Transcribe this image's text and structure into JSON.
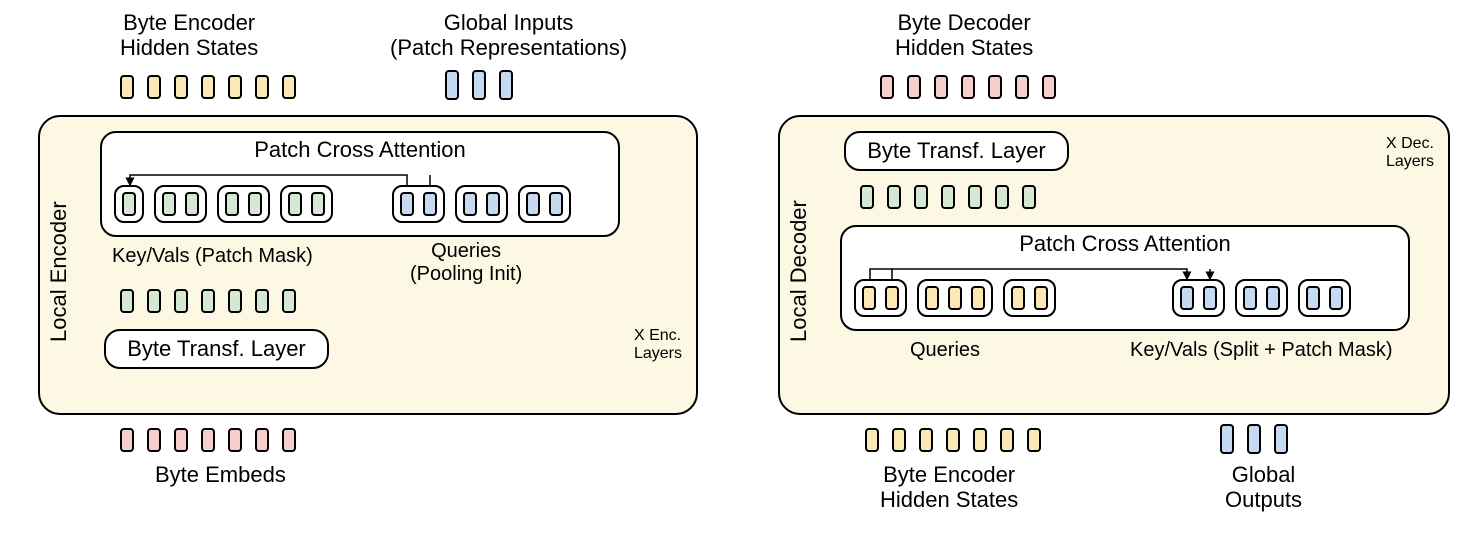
{
  "encoder": {
    "top_left_label": "Byte Encoder\nHidden States",
    "top_right_label": "Global Inputs\n(Patch Representations)",
    "side_label": "Local Encoder",
    "pca_title": "Patch Cross Attention",
    "keyvals_label": "Key/Vals (Patch Mask)",
    "queries_label": "Queries\n(Pooling Init)",
    "byte_layer_label": "Byte Transf. Layer",
    "layers_note": "X Enc.\nLayers",
    "bottom_label": "Byte Embeds",
    "tokens": {
      "top_yellow": 7,
      "top_blue": 3,
      "mid_green": 7,
      "bottom_pink": 7,
      "pca_green_groups": [
        1,
        2,
        2,
        2
      ],
      "pca_blue_groups": [
        2,
        2,
        2
      ]
    }
  },
  "decoder": {
    "top_label": "Byte Decoder\nHidden States",
    "side_label": "Local Decoder",
    "byte_layer_label": "Byte Transf. Layer",
    "pca_title": "Patch Cross Attention",
    "queries_label": "Queries",
    "keyvals_label": "Key/Vals (Split + Patch Mask)",
    "layers_note": "X Dec.\nLayers",
    "bottom_left_label": "Byte Encoder\nHidden States",
    "bottom_right_label": "Global\nOutputs",
    "tokens": {
      "top_pink": 7,
      "mid_green": 7,
      "bottom_yellow": 7,
      "bottom_blue": 3,
      "pca_yellow_groups": [
        2,
        3,
        2
      ],
      "pca_blue_groups": [
        2,
        2,
        2
      ]
    }
  },
  "colors": {
    "yellow": "#fce8b2",
    "blue": "#c5d9f1",
    "green": "#d5e8d4",
    "pink": "#f8cecc",
    "panel_bg": "#fcf8e3"
  }
}
